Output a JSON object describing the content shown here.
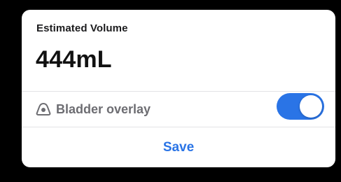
{
  "card": {
    "title": "Estimated Volume",
    "volume": "444mL"
  },
  "overlay": {
    "icon": "bladder-icon",
    "label": "Bladder overlay",
    "enabled": true
  },
  "actions": {
    "save_label": "Save"
  },
  "colors": {
    "accent": "#2a74e6",
    "background": "#000000",
    "card": "#ffffff",
    "secondary_text": "#6d6d72"
  }
}
